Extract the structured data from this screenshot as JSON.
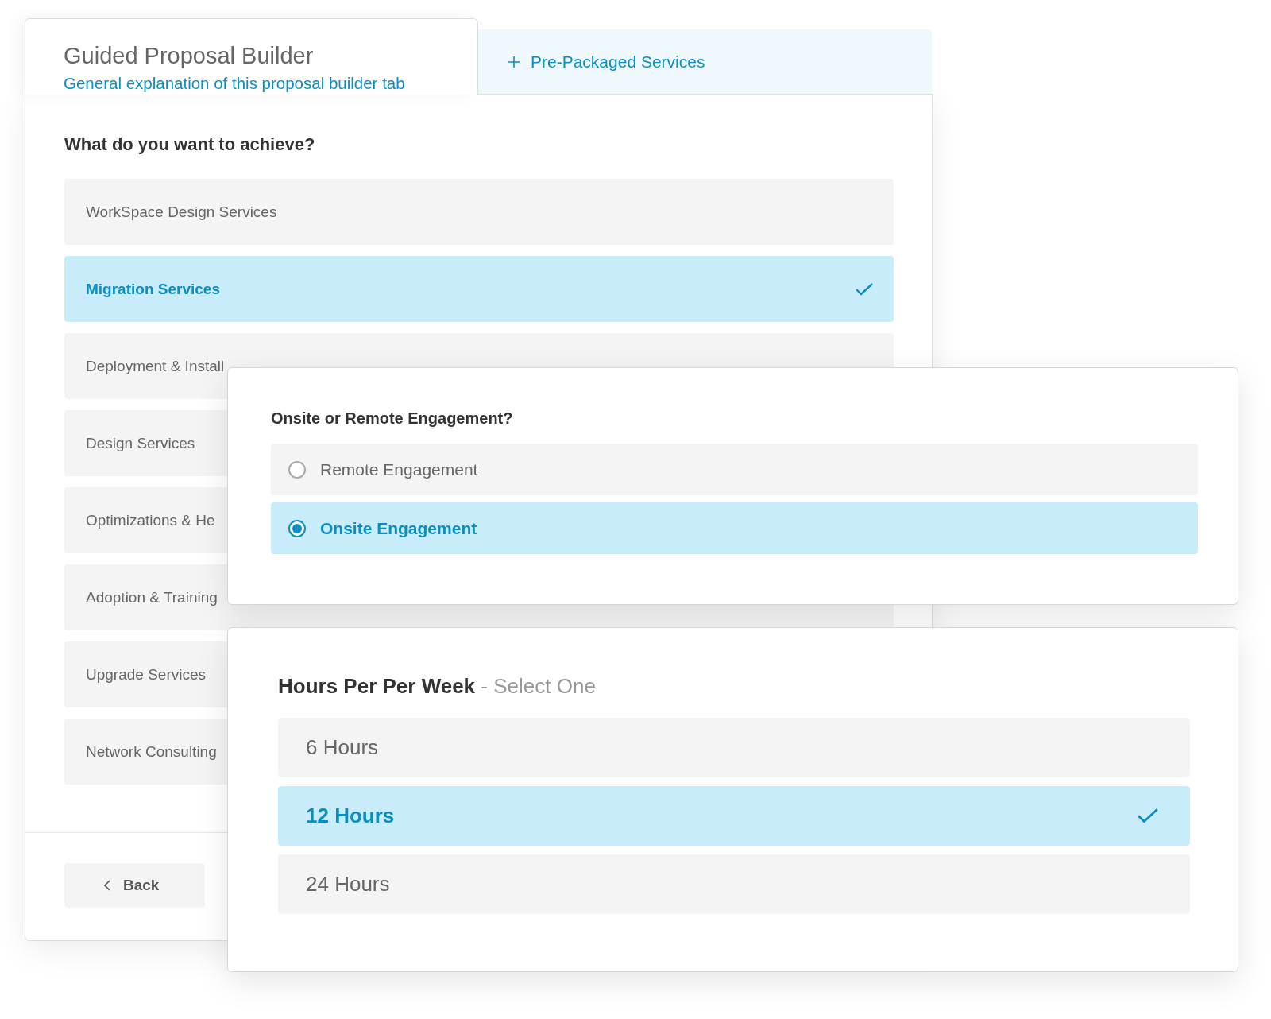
{
  "tabs": [
    {
      "title": "Guided Proposal Builder",
      "subtitle": "General explanation of this proposal builder tab",
      "selected": true
    },
    {
      "title": "Pre-Packaged Services",
      "selected": false
    }
  ],
  "services": {
    "question": "What do you want to achieve?",
    "options": [
      {
        "label": "WorkSpace Design Services",
        "selected": false
      },
      {
        "label": "Migration Services",
        "selected": true
      },
      {
        "label": "Deployment & Install",
        "selected": false
      },
      {
        "label": "Design Services",
        "selected": false
      },
      {
        "label": "Optimizations & He",
        "selected": false
      },
      {
        "label": "Adoption & Training",
        "selected": false
      },
      {
        "label": "Upgrade Services",
        "selected": false
      },
      {
        "label": "Network Consulting",
        "selected": false
      }
    ]
  },
  "back_button": {
    "label": "Back"
  },
  "engagement": {
    "question": "Onsite or Remote Engagement?",
    "options": [
      {
        "label": "Remote Engagement",
        "selected": false
      },
      {
        "label": "Onsite Engagement",
        "selected": true
      }
    ]
  },
  "hours": {
    "title": "Hours Per Per Week",
    "hint": "- Select One",
    "options": [
      {
        "label": "6 Hours",
        "selected": false
      },
      {
        "label": "12 Hours",
        "selected": true
      },
      {
        "label": "24 Hours",
        "selected": false
      }
    ]
  }
}
